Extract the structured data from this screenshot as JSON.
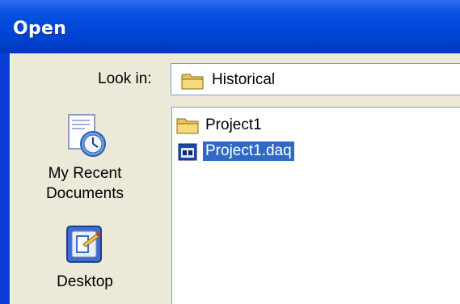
{
  "window": {
    "title": "Open"
  },
  "look_in": {
    "label": "Look in:",
    "value": "Historical",
    "icon": "folder-icon"
  },
  "places": [
    {
      "label_line1": "My Recent",
      "label_line2": "Documents",
      "icon": "recent-documents-icon"
    },
    {
      "label_line1": "Desktop",
      "icon": "desktop-icon"
    }
  ],
  "files": [
    {
      "name": "Project1",
      "icon": "folder-icon",
      "selected": false
    },
    {
      "name": "Project1.daq",
      "icon": "daq-file-icon",
      "selected": true
    }
  ],
  "colors": {
    "titlebar": "#0046d8",
    "dialog_bg": "#ece9d8",
    "selection": "#316ac5"
  }
}
